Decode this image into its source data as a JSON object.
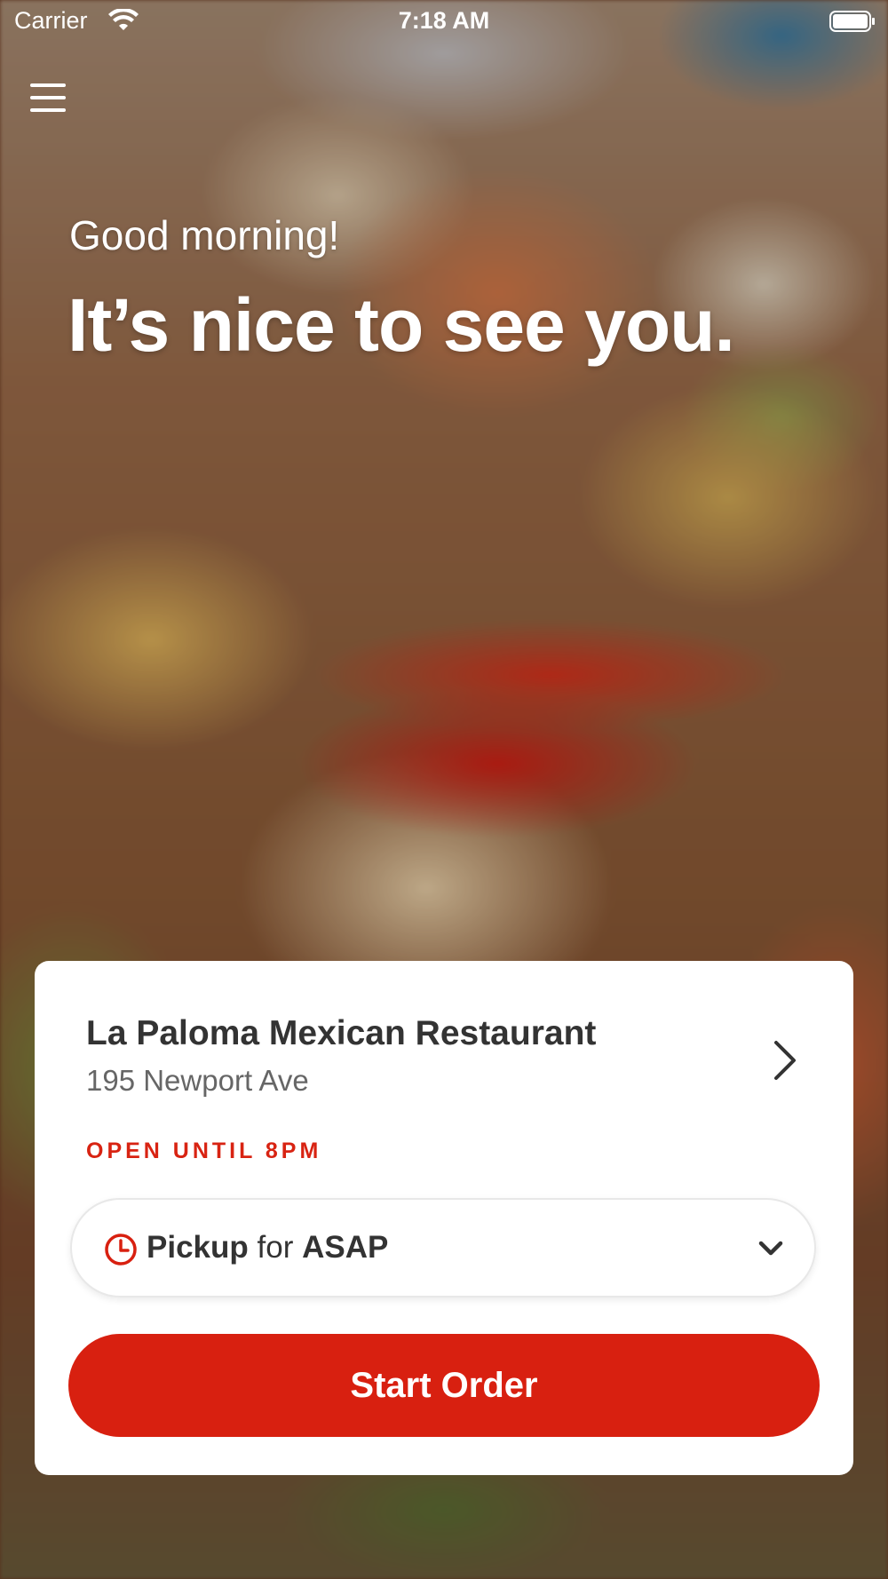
{
  "status_bar": {
    "carrier": "Carrier",
    "time": "7:18 AM"
  },
  "hero": {
    "greeting": "Good morning!",
    "headline": "It’s nice to see you."
  },
  "restaurant": {
    "name": "La Paloma Mexican Restaurant",
    "address": "195 Newport Ave",
    "status": "OPEN UNTIL 8PM"
  },
  "order_mode": {
    "mode": "Pickup",
    "connector": "for",
    "time": "ASAP"
  },
  "actions": {
    "start_order": "Start Order"
  },
  "colors": {
    "accent": "#d82010",
    "status_text": "#d82312"
  }
}
